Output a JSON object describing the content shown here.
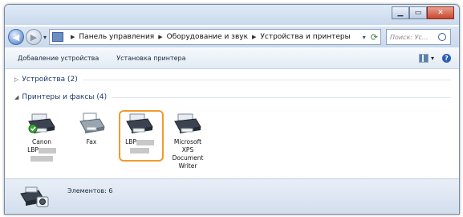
{
  "address": {
    "crumbs": [
      "Панель управления",
      "Оборудование и звук",
      "Устройства и принтеры"
    ],
    "search_placeholder": "Поиск: Ус..."
  },
  "toolbar": {
    "add_device": "Добавление устройства",
    "add_printer": "Установка принтера"
  },
  "groups": {
    "devices": "Устройства (2)",
    "printers": "Принтеры и факсы (4)"
  },
  "printers": [
    {
      "line1": "Canon",
      "line2": "LBP",
      "icon": "printer-default-icon"
    },
    {
      "line1": "Fax",
      "icon": "fax-icon"
    },
    {
      "line1": "LBP",
      "icon": "printer-icon"
    },
    {
      "line1": "Microsoft",
      "line2": "XPS",
      "line3": "Document",
      "line4": "Writer",
      "icon": "printer-icon"
    }
  ],
  "status": {
    "count": "Элементов: 6"
  },
  "colors": {
    "selection": "#f29a2e",
    "accent": "#2b5fb2"
  }
}
